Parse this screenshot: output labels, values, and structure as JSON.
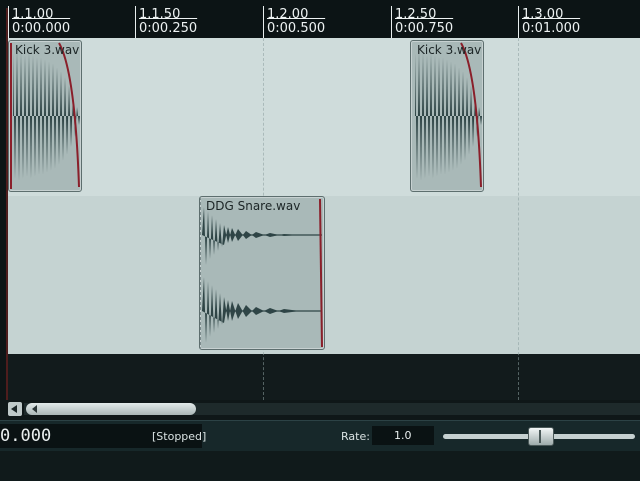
{
  "ruler": {
    "marks": [
      {
        "bar": "1.1.00",
        "time": "0:00.000"
      },
      {
        "bar": "1.1.50",
        "time": "0:00.250"
      },
      {
        "bar": "1.2.00",
        "time": "0:00.500"
      },
      {
        "bar": "1.2.50",
        "time": "0:00.750"
      },
      {
        "bar": "1.3.00",
        "time": "0:01.000"
      }
    ]
  },
  "tracks": {
    "track1": {
      "items": [
        {
          "label": "Kick 3.wav"
        },
        {
          "label": "Kick 3.wav"
        }
      ]
    },
    "track2": {
      "items": [
        {
          "label": "DDG Snare.wav"
        }
      ]
    }
  },
  "transport": {
    "time_readout": "0.000",
    "status": "[Stopped]",
    "rate_label": "Rate:",
    "rate_value": "1.0",
    "rate_slider_level": 1.0
  },
  "colors": {
    "item_fill": "#a9b9b8",
    "waveform": "#2f4546",
    "envelope": "#8a1f2a",
    "track_bg": "#cfdcdb"
  }
}
